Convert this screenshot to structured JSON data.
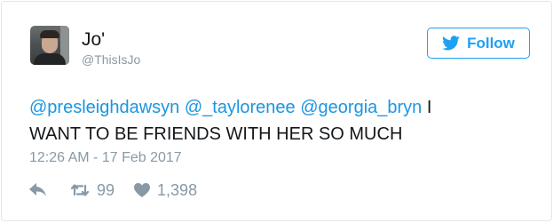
{
  "user": {
    "display_name": "Jo'",
    "handle": "@ThisIsJo"
  },
  "follow": {
    "label": "Follow",
    "icon": "twitter-bird-icon",
    "color": "#1da1f2"
  },
  "tweet": {
    "mentions": [
      "@presleighdawsyn",
      "@_taylorenee",
      "@georgia_bryn"
    ],
    "text_after_mentions": "I",
    "text_line_2": "WANT TO BE FRIENDS WITH HER SO MUCH",
    "timestamp": "12:26 AM - 17 Feb 2017"
  },
  "actions": {
    "reply_icon": "reply-icon",
    "retweet_icon": "retweet-icon",
    "retweet_count": "99",
    "like_icon": "heart-icon",
    "like_count": "1,398"
  }
}
